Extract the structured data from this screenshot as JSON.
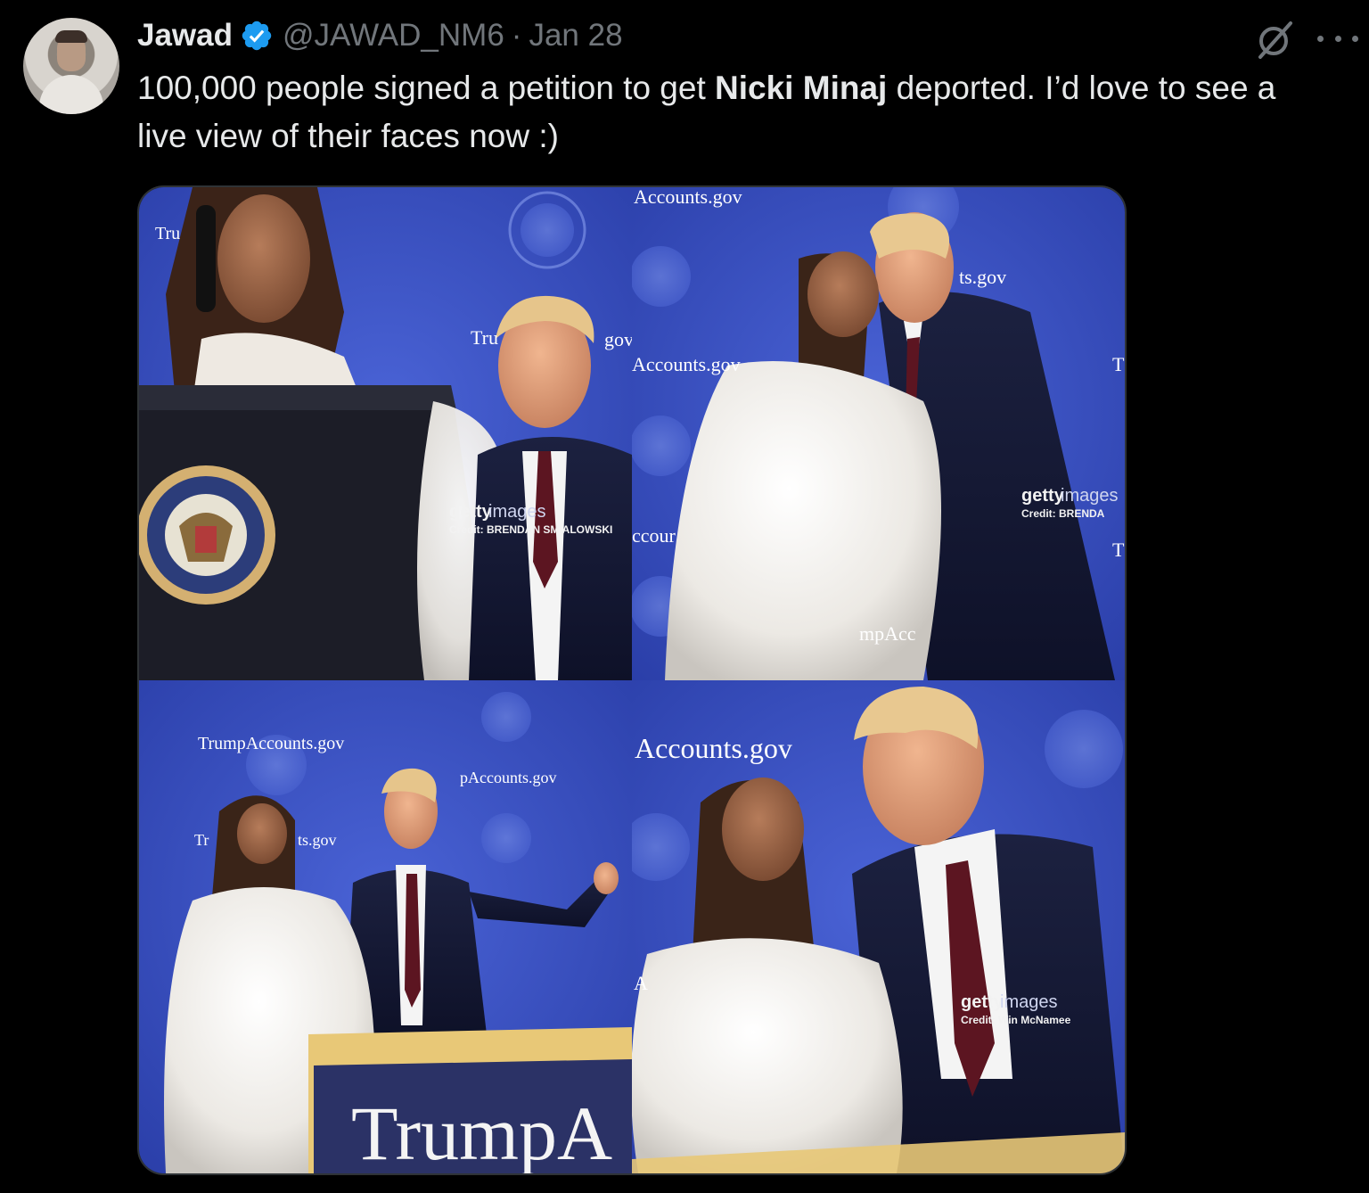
{
  "author": {
    "name": "Jawad",
    "handle": "@JAWAD_NM6",
    "separator": "·",
    "date": "Jan 28",
    "verified": true
  },
  "tweet": {
    "text_before": "100,000 people signed a petition to get ",
    "text_bold": "Nicki Minaj",
    "text_after": " deported. I’d love to see a live view of their faces now :)"
  },
  "icons": {
    "avatar": "avatar",
    "verified": "verified-badge-icon",
    "grok": "grok-icon",
    "more": "more-options-icon"
  },
  "media": {
    "panels": [
      {
        "backdrop": [
          "Tru",
          "Tru",
          "gov"
        ],
        "watermark_brand": "getty",
        "watermark_suffix": "images",
        "watermark_credit": "Credit: BRENDAN SMIALOWSKI"
      },
      {
        "backdrop": [
          "Accounts.gov",
          "Accounts.gov",
          "ccour",
          "ts.gov",
          "T",
          "T",
          "mpAcc"
        ],
        "watermark_brand": "getty",
        "watermark_suffix": "images",
        "watermark_credit": "Credit: BRENDA"
      },
      {
        "backdrop": [
          "TrumpAccounts.gov",
          "pAccounts.gov",
          "Tr",
          "ts.gov"
        ],
        "podium": "TrumpA"
      },
      {
        "backdrop": [
          "Accounts.gov",
          "A"
        ],
        "watermark_brand": "getty",
        "watermark_suffix": "images",
        "watermark_credit": "Credit: Win McNamee"
      }
    ]
  },
  "colors": {
    "background": "#000000",
    "text": "#e7e9ea",
    "muted": "#71767b",
    "verified": "#1d9bf0",
    "stage_blue": "#3a54c6"
  }
}
